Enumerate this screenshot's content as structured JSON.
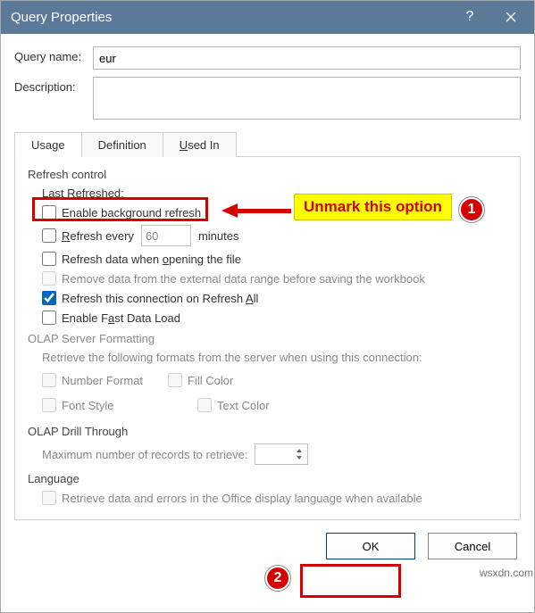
{
  "title": "Query Properties",
  "fields": {
    "query_name_label": "Query name:",
    "query_name_value": "eur",
    "description_label": "Description:",
    "description_value": ""
  },
  "tabs": {
    "usage": "Usage",
    "definition": "Definition",
    "used_in": "Used In"
  },
  "refresh": {
    "title": "Refresh control",
    "last_refreshed": "Last Refreshed:",
    "enable_bg": "Enable background refresh",
    "refresh_every_pre": "Refresh every",
    "refresh_every_val": "60",
    "refresh_every_unit": "minutes",
    "refresh_on_open": "Refresh data when opening the file",
    "remove_data": "Remove data from the external data range before saving the workbook",
    "refresh_all": "Refresh this connection on Refresh All",
    "fast_load": "Enable Fast Data Load"
  },
  "olap_fmt": {
    "title": "OLAP Server Formatting",
    "desc": "Retrieve the following formats from the server when using this connection:",
    "number_format": "Number Format",
    "fill_color": "Fill Color",
    "font_style": "Font Style",
    "text_color": "Text Color"
  },
  "olap_drill": {
    "title": "OLAP Drill Through",
    "label": "Maximum number of records to retrieve:"
  },
  "language": {
    "title": "Language",
    "label": "Retrieve data and errors in the Office display language when available"
  },
  "buttons": {
    "ok": "OK",
    "cancel": "Cancel"
  },
  "annotations": {
    "unmark": "Unmark this option",
    "step1": "1",
    "step2": "2"
  },
  "watermark": "wsxdn.com"
}
